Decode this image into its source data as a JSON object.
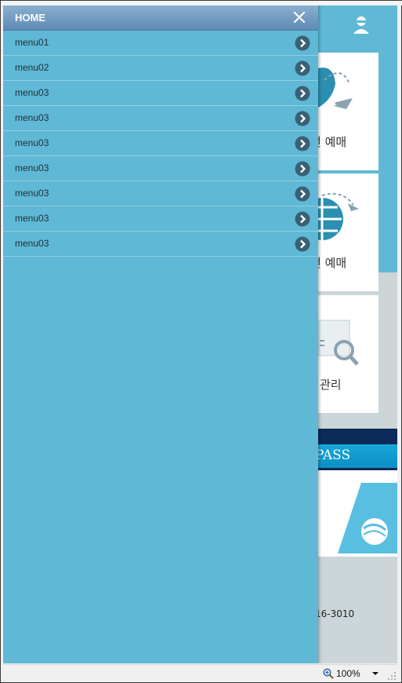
{
  "menu": {
    "header_title": "HOME",
    "close_icon": "close-icon",
    "items": [
      {
        "label": "menu01"
      },
      {
        "label": "menu02"
      },
      {
        "label": "menu03"
      },
      {
        "label": "menu03"
      },
      {
        "label": "menu03"
      },
      {
        "label": "menu03"
      },
      {
        "label": "menu03"
      },
      {
        "label": "menu03"
      },
      {
        "label": "menu03"
      }
    ]
  },
  "background_page": {
    "card1_label": "선 예매",
    "card2_label": "선 예매",
    "card3_label": "관리",
    "banner_text": "PASS",
    "phone_text": "16-3010"
  },
  "statusbar": {
    "zoom": "100%"
  },
  "colors": {
    "menu_bg": "#5fb8d5",
    "header_gradient_top": "#8ab0cf",
    "header_gradient_bottom": "#5e8ab6",
    "arrow_bg": "#3b6073",
    "divider": "#8fd0e5"
  }
}
